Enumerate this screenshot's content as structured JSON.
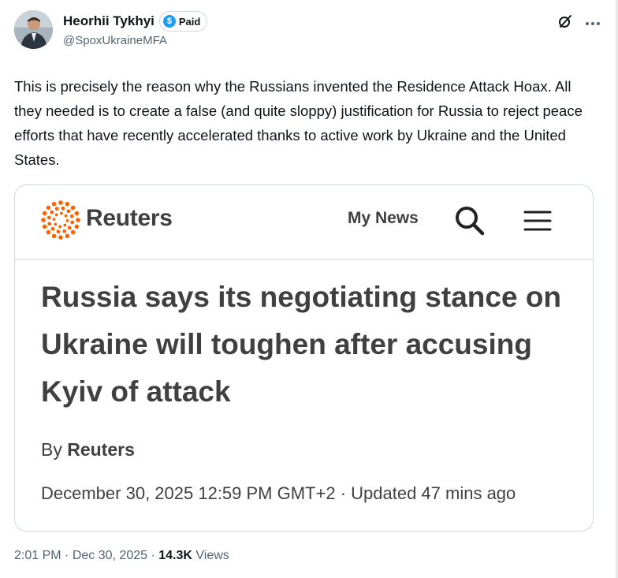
{
  "author": {
    "name": "Heorhii Tykhyi",
    "badge": "Paid",
    "badge_symbol": "$",
    "handle": "@SpoxUkraineMFA"
  },
  "tweet": {
    "text": "This is precisely the reason why the Russians invented the Residence Attack Hoax. All they needed is to create a false (and quite sloppy) justification for Russia to reject peace efforts that have recently accelerated thanks to active work by Ukraine and the United States."
  },
  "card": {
    "brand": "Reuters",
    "nav_link": "My News",
    "headline": "Russia says its negotiating stance on Ukraine will toughen after accusing Kyiv of attack",
    "byline_prefix": "By",
    "byline_author": "Reuters",
    "dateline": "December 30, 2025 12:59 PM GMT+2 · Updated 47 mins ago",
    "brand_color": "#fa6400"
  },
  "meta": {
    "time": "2:01 PM",
    "sep1": "·",
    "date": "Dec 30, 2025",
    "sep2": "·",
    "views_count": "14.3K",
    "views_label": "Views"
  },
  "icons": [
    "grok-icon",
    "more-icon",
    "search-icon",
    "menu-icon",
    "reuters-logo-icon"
  ]
}
